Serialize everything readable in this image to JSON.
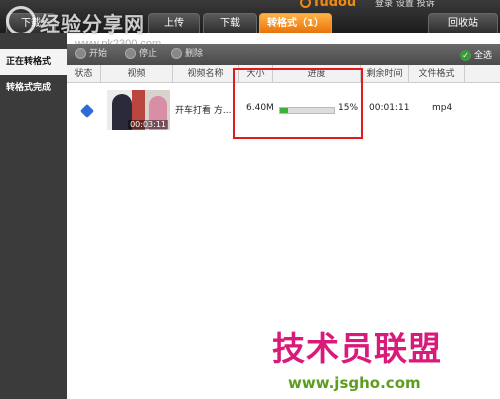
{
  "topbar": {
    "brand": "Tudou",
    "links": "登录  设置  投诉",
    "tabs": [
      "下载",
      "上传",
      "下载",
      "转格式（1）",
      "回收站"
    ]
  },
  "watermarks": {
    "top": "经验分享网",
    "url": "www.pk2300.com",
    "big": "技术员联盟",
    "small": "www.jsgho.com"
  },
  "sidebar": {
    "items": [
      "正在转格式",
      "转格式完成"
    ]
  },
  "toolbar": {
    "start": "开始",
    "stop": "停止",
    "delete": "删除",
    "select_all": "全选"
  },
  "table": {
    "headers": [
      "状态",
      "视频",
      "视频名称",
      "大小",
      "进度",
      "剩余时间",
      "文件格式"
    ],
    "rows": [
      {
        "thumb_time": "00:03:11",
        "name": "开车打看 方...",
        "size": "6.40M",
        "progress_label": "15%",
        "progress_value": 15,
        "remaining": "00:01:11",
        "format": "mp4"
      }
    ]
  },
  "colors": {
    "accent": "#f08a10",
    "progress": "#3bb03b",
    "highlight": "#e31a1a"
  }
}
